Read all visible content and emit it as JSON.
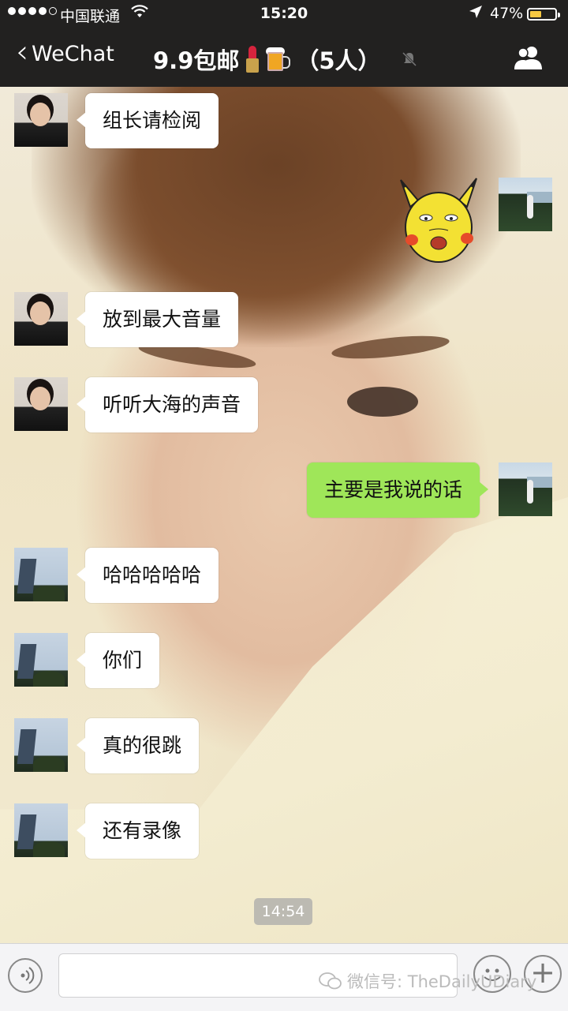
{
  "status_bar": {
    "carrier": "中国联通",
    "time": "15:20",
    "battery_percent": "47%",
    "battery_level": 0.47,
    "battery_color": "#f6c842"
  },
  "nav": {
    "back_label": "WeChat",
    "title_prefix": "9.9包邮",
    "title_suffix": "（5人）",
    "title_emojis": [
      "lipstick-icon",
      "beer-icon"
    ],
    "right_icon": "group-members-icon",
    "mute_icon": "mute-bell-icon"
  },
  "messages": [
    {
      "side": "left",
      "avatar": "girl",
      "text": "组长请检阅"
    },
    {
      "side": "right",
      "avatar": "lake",
      "sticker": "pikachu-meme-sticker"
    },
    {
      "side": "left",
      "avatar": "girl",
      "text": "放到最大音量"
    },
    {
      "side": "left",
      "avatar": "girl",
      "text": "听听大海的声音"
    },
    {
      "side": "right",
      "avatar": "lake",
      "text": "主要是我说的话"
    },
    {
      "side": "left",
      "avatar": "building",
      "text": "哈哈哈哈哈"
    },
    {
      "side": "left",
      "avatar": "building",
      "text": "你们"
    },
    {
      "side": "left",
      "avatar": "building",
      "text": "真的很跳"
    },
    {
      "side": "left",
      "avatar": "building",
      "text": "还有录像"
    }
  ],
  "timestamp": "14:54",
  "input": {
    "voice_icon": "voice-icon",
    "emoji_icon": "emoji-icon",
    "plus_icon": "plus-icon",
    "plus_symbol": "+"
  },
  "watermark": "微信号: TheDailyUDiary",
  "colors": {
    "bar_bg": "#222120",
    "self_bubble": "#9fe659",
    "other_bubble": "#ffffff"
  }
}
